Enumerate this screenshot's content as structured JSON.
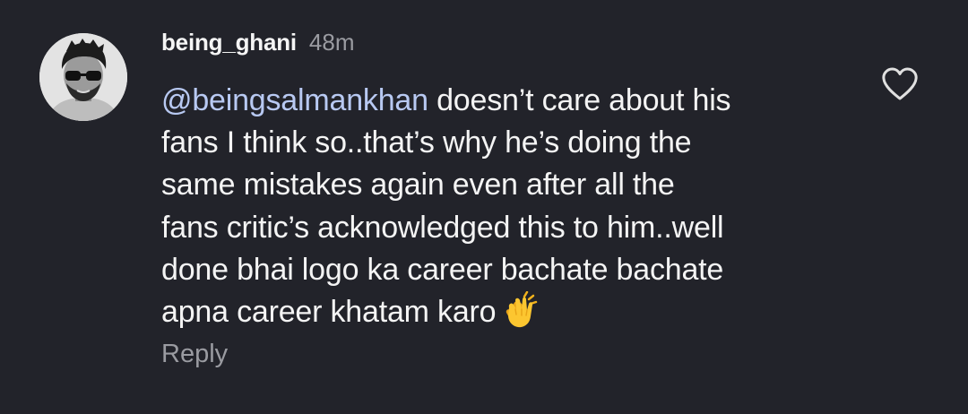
{
  "comment": {
    "username": "being_ghani",
    "timestamp": "48m",
    "mention": "@beingsalmankhan",
    "lines": [
      " doesn’t care about his",
      "fans I think so..that’s why he’s doing the",
      "same mistakes again even after all the",
      "fans critic’s acknowledged this to him..well",
      "done bhai logo ka career bachate bachate",
      "apna career khatam karo"
    ],
    "emoji": "clapping-hands-icon",
    "reply_label": "Reply"
  },
  "icons": {
    "like": "heart-outline-icon",
    "avatar": "avatar"
  },
  "colors": {
    "background": "#22232a",
    "text": "#f4f4f4",
    "mention": "#b8c9f2",
    "muted": "#9a9ba1"
  }
}
